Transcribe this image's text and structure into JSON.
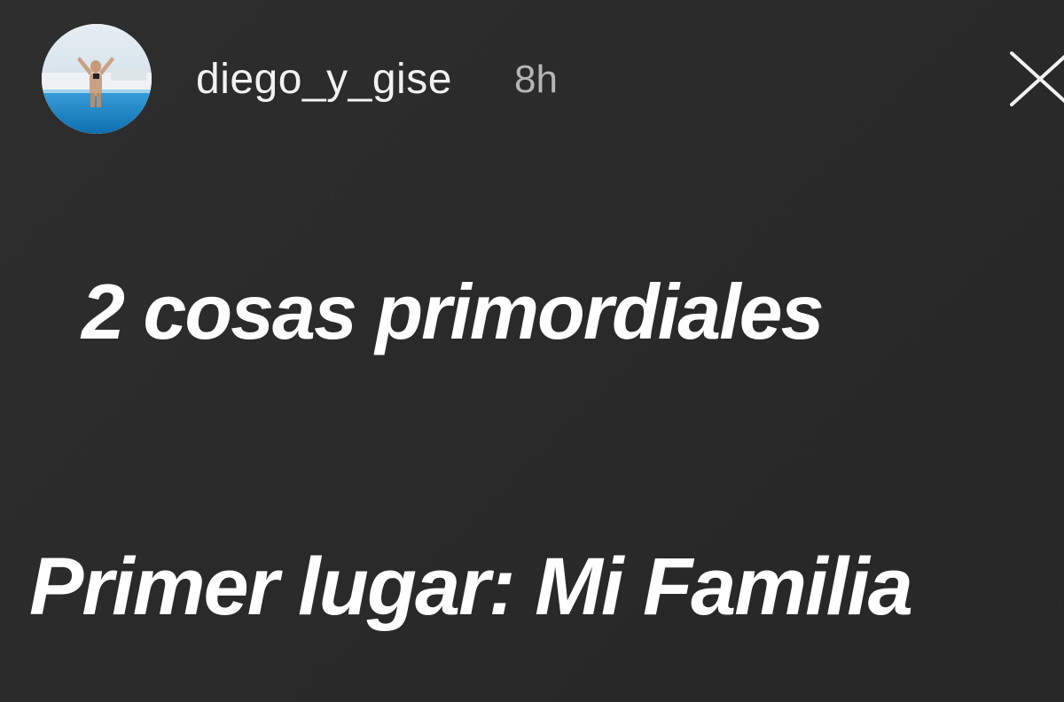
{
  "story": {
    "user": {
      "username": "diego_y_gise",
      "timestamp": "8h"
    },
    "close_icon": "close-icon",
    "lines": [
      "2 cosas primordiales",
      "Primer lugar: Mi Familia"
    ]
  },
  "colors": {
    "background": "#2a2a2a",
    "text": "#ffffff",
    "timestamp": "#b5b5b5"
  }
}
